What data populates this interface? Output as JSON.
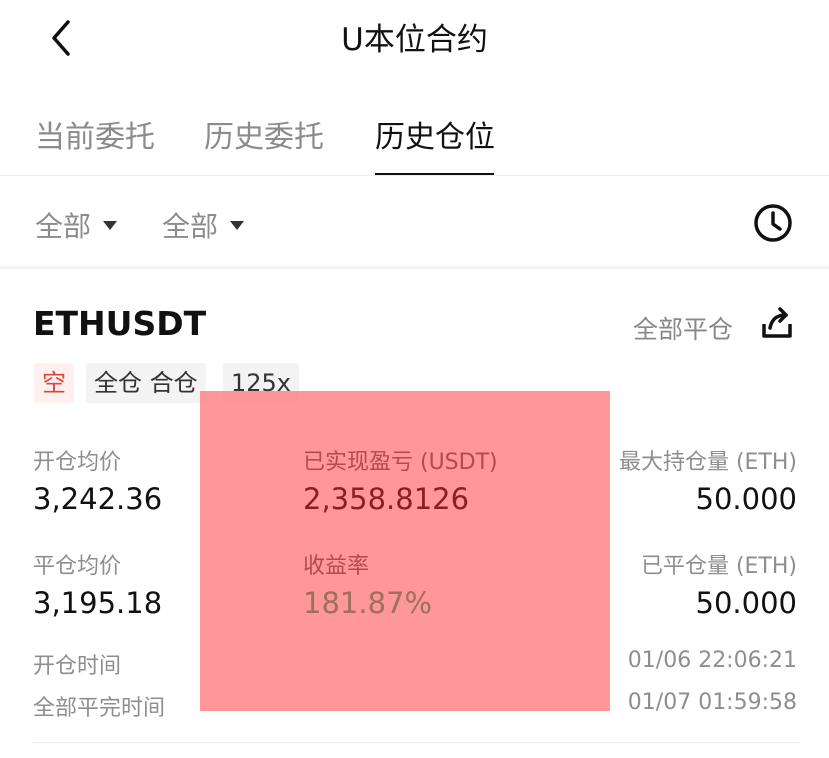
{
  "header": {
    "title": "U本位合约"
  },
  "tabs": [
    {
      "label": "当前委托",
      "active": false
    },
    {
      "label": "历史委托",
      "active": false
    },
    {
      "label": "历史仓位",
      "active": true
    }
  ],
  "filters": [
    {
      "label": "全部"
    },
    {
      "label": "全部"
    }
  ],
  "position": {
    "symbol": "ETHUSDT",
    "close_all_label": "全部平仓",
    "tags": [
      "空",
      "全仓 合仓",
      "125x"
    ],
    "open_avg_label": "开仓均价",
    "open_avg_value": "3,242.36",
    "realized_pnl_label": "已实现盈亏 (USDT)",
    "realized_pnl_value": "2,358.8126",
    "max_hold_label": "最大持仓量 (ETH)",
    "max_hold_value": "50.000",
    "close_avg_label": "平仓均价",
    "close_avg_value": "3,195.18",
    "yield_label": "收益率",
    "yield_value": "181.87%",
    "closed_qty_label": "已平仓量 (ETH)",
    "closed_qty_value": "50.000",
    "open_time_label": "开仓时间",
    "open_time_value": "01/06 22:06:21",
    "close_time_label": "全部平完时间",
    "close_time_value": "01/07 01:59:58"
  },
  "icons": {
    "back": "chevron-left-icon",
    "history": "clock-icon",
    "share": "share-icon"
  },
  "colors": {
    "short_tag": "#e0453b",
    "overlay": "#ff787c"
  }
}
